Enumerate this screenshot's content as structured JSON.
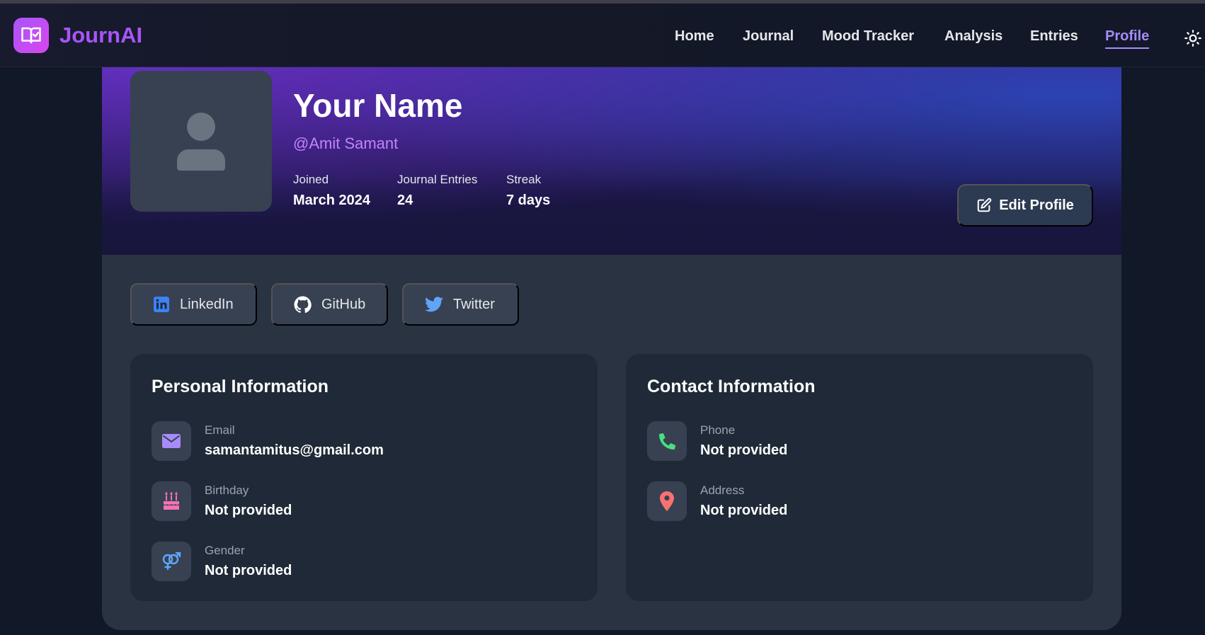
{
  "app": {
    "brand": "JournAI"
  },
  "nav": {
    "items": [
      {
        "label": "Home"
      },
      {
        "label": "Journal"
      },
      {
        "label": "Mood Tracker"
      },
      {
        "label": "Analysis"
      },
      {
        "label": "Entries"
      },
      {
        "label": "Profile",
        "active": true
      }
    ]
  },
  "profile": {
    "name": "Your Name",
    "handle": "@Amit Samant",
    "stats": [
      {
        "label": "Joined",
        "value": "March 2024"
      },
      {
        "label": "Journal Entries",
        "value": "24"
      },
      {
        "label": "Streak",
        "value": "7 days"
      }
    ],
    "edit_label": "Edit Profile"
  },
  "social": [
    {
      "label": "LinkedIn",
      "icon": "linkedin-icon",
      "color": "#3b82f6"
    },
    {
      "label": "GitHub",
      "icon": "github-icon",
      "color": "#ffffff"
    },
    {
      "label": "Twitter",
      "icon": "twitter-icon",
      "color": "#60a5fa"
    }
  ],
  "personal": {
    "title": "Personal Information",
    "rows": [
      {
        "label": "Email",
        "value": "samantamitus@gmail.com",
        "icon": "envelope-icon",
        "color": "#a78bfa"
      },
      {
        "label": "Birthday",
        "value": "Not provided",
        "icon": "cake-icon",
        "color": "#f472b6"
      },
      {
        "label": "Gender",
        "value": "Not provided",
        "icon": "gender-icon",
        "color": "#60a5fa"
      }
    ]
  },
  "contact": {
    "title": "Contact Information",
    "rows": [
      {
        "label": "Phone",
        "value": "Not provided",
        "icon": "phone-icon",
        "color": "#4ade80"
      },
      {
        "label": "Address",
        "value": "Not provided",
        "icon": "map-pin-icon",
        "color": "#f87171"
      }
    ]
  },
  "colors": {
    "accent": "#a855f7",
    "nav_active": "#a78bfa",
    "handle": "#c084fc",
    "page_bg": "#111827",
    "card_bg": "#2a3342",
    "panel_bg": "#1f2937"
  }
}
